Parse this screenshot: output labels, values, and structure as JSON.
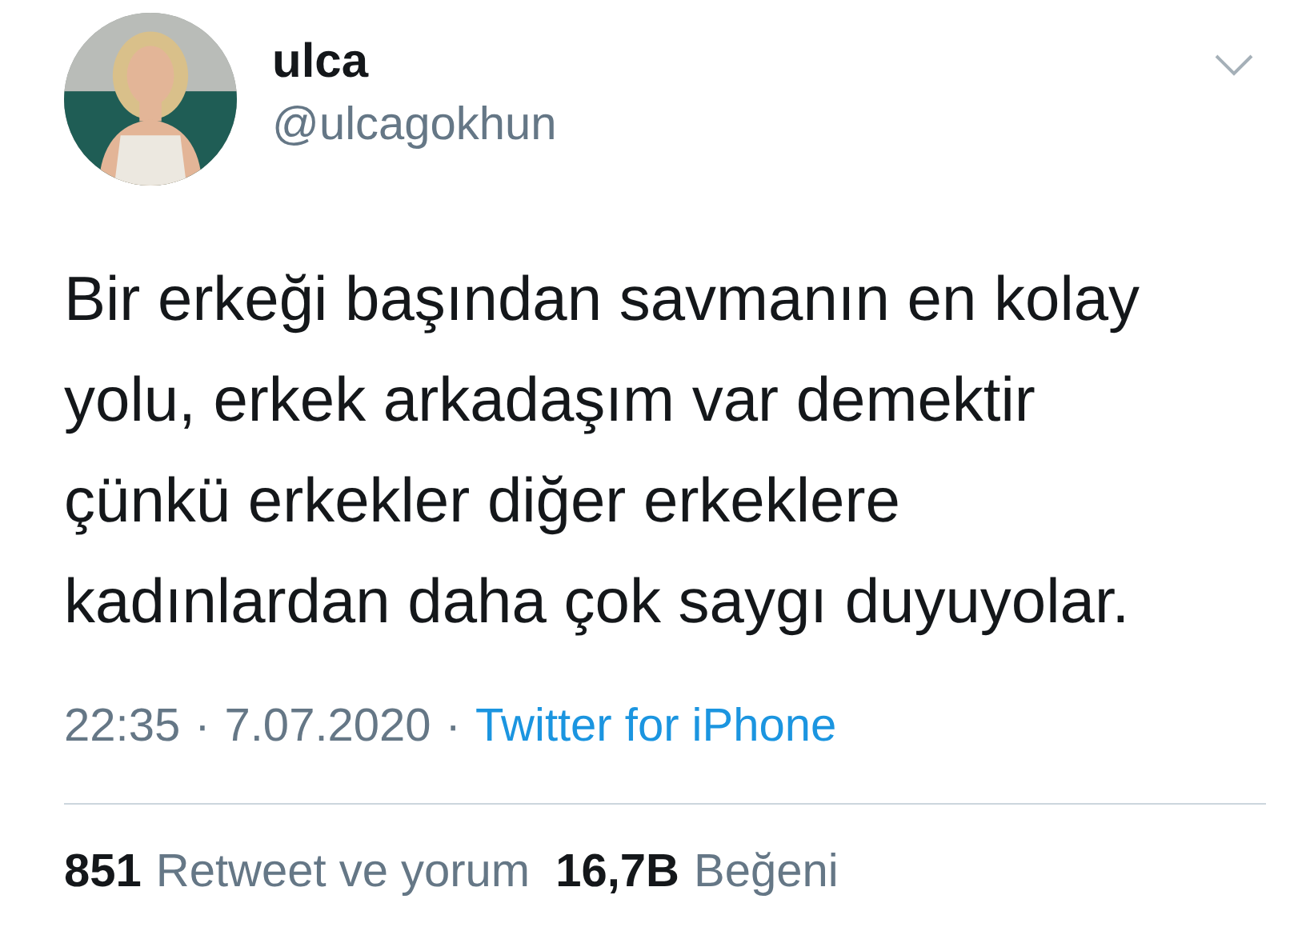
{
  "author": {
    "name": "ulca",
    "handle": "@ulcagokhun"
  },
  "tweet": {
    "text": "Bir erkeği başından savmanın en kolay\nyolu, erkek arkadaşım var demektir\nçünkü erkekler diğer erkeklere\nkadınlardan daha çok saygı duyuyolar.",
    "time": "22:35",
    "separator": "·",
    "date": "7.07.2020",
    "source": "Twitter for iPhone"
  },
  "stats": [
    {
      "count": "851",
      "label": "Retweet ve yorum"
    },
    {
      "count": "16,7B",
      "label": "Beğeni"
    }
  ]
}
